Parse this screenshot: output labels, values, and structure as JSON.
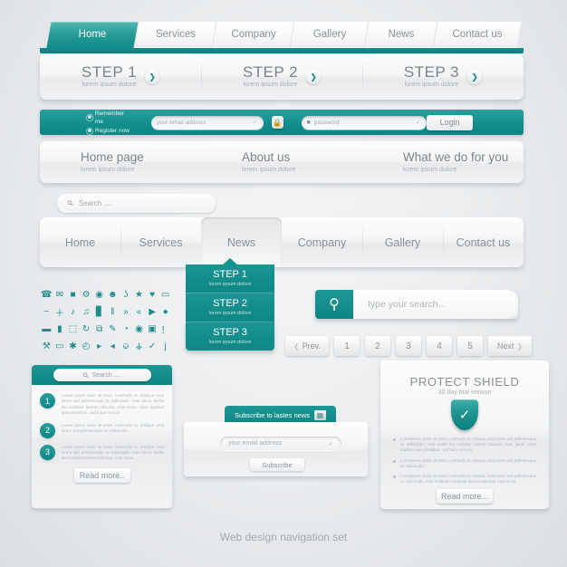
{
  "caption": "Web design navigation set",
  "colors": {
    "teal_light": "#36a5a1",
    "teal_mid": "#1d9492",
    "teal_dark": "#0c8584",
    "panel_light": "#fdfdfd",
    "panel_shadow": "#e9eaec",
    "text_grey": "#8b9094",
    "text_light": "#aeb3b7",
    "page_bg": "#eceef0"
  },
  "top_nav": {
    "active_index": 0,
    "tabs": [
      {
        "label": "Home"
      },
      {
        "label": "Services"
      },
      {
        "label": "Company"
      },
      {
        "label": "Gallery"
      },
      {
        "label": "News"
      },
      {
        "label": "Contact us"
      }
    ]
  },
  "steps_strip": {
    "items": [
      {
        "title": "STEP 1",
        "subtitle": "lorem ipsum dolore",
        "arrow": "chevron-right-icon"
      },
      {
        "title": "STEP 2",
        "subtitle": "lorem ipsum dolore",
        "arrow": "chevron-right-icon"
      },
      {
        "title": "STEP 3",
        "subtitle": "lorem ipsum dolore",
        "arrow": "chevron-right-icon"
      }
    ]
  },
  "login_bar": {
    "remember_me": "Remember me",
    "register_now": "Register now",
    "email_placeholder": "your email address",
    "password_placeholder": "password",
    "login_label": "Login",
    "lock_icon": "lock-icon",
    "check_icon": "check-icon"
  },
  "info_strip": {
    "items": [
      {
        "title": "Home page",
        "subtitle": "lorem ipsum dolore"
      },
      {
        "title": "About us",
        "subtitle": "lorem ipsum dolore"
      },
      {
        "title": "What we do for you",
        "subtitle": "lorem ipsum dolore"
      }
    ]
  },
  "small_search": {
    "placeholder": "Search ....",
    "icon": "search-icon"
  },
  "main_nav": {
    "active_index": 2,
    "items": [
      {
        "label": "Home"
      },
      {
        "label": "Services"
      },
      {
        "label": "News"
      },
      {
        "label": "Company"
      },
      {
        "label": "Gallery"
      },
      {
        "label": "Contact us"
      }
    ]
  },
  "dropdown": {
    "items": [
      {
        "title": "STEP 1",
        "subtitle": "lorem ipsum dolore"
      },
      {
        "title": "STEP 2",
        "subtitle": "lorem ipsum dolore"
      },
      {
        "title": "STEP 3",
        "subtitle": "lorem ipsum dolore"
      }
    ]
  },
  "icon_grid": {
    "rows": [
      [
        {
          "name": "phone-icon",
          "glyph": "✆"
        },
        {
          "name": "envelope-icon",
          "glyph": "✉"
        },
        {
          "name": "briefcase-icon",
          "glyph": "ὋC"
        },
        {
          "name": "gear-icon",
          "glyph": "⚙"
        },
        {
          "name": "globe-icon",
          "glyph": "◉"
        },
        {
          "name": "user-icon",
          "glyph": "☻"
        },
        {
          "name": "rss-icon",
          "glyph": "ʖ"
        },
        {
          "name": "star-icon",
          "glyph": "★"
        },
        {
          "name": "heart-icon",
          "glyph": "♥"
        },
        {
          "name": "comment-icon",
          "glyph": "▭"
        }
      ],
      [
        {
          "name": "minus-icon",
          "glyph": "−"
        },
        {
          "name": "plus-icon",
          "glyph": "＋"
        },
        {
          "name": "volume-mute-icon",
          "glyph": "ὐ7"
        },
        {
          "name": "volume-up-icon",
          "glyph": "ὐ8"
        },
        {
          "name": "equalizer-icon",
          "glyph": "▐"
        },
        {
          "name": "pause-icon",
          "glyph": "‖"
        },
        {
          "name": "forward-icon",
          "glyph": "»"
        },
        {
          "name": "backward-icon",
          "glyph": "«"
        },
        {
          "name": "play-icon",
          "glyph": "▶"
        },
        {
          "name": "map-pin-icon",
          "glyph": "⮟"
        }
      ],
      [
        {
          "name": "briefcase-alt-icon",
          "glyph": "▬"
        },
        {
          "name": "trash-icon",
          "glyph": "▮"
        },
        {
          "name": "fullscreen-icon",
          "glyph": "⬚"
        },
        {
          "name": "refresh-icon",
          "glyph": "↻"
        },
        {
          "name": "tag-icon",
          "glyph": "⧉"
        },
        {
          "name": "pencil-icon",
          "glyph": "✎"
        },
        {
          "name": "pie-chart-icon",
          "glyph": "◔"
        },
        {
          "name": "eye-icon",
          "glyph": "◉"
        },
        {
          "name": "save-icon",
          "glyph": "▣"
        },
        {
          "name": "exclamation-icon",
          "glyph": "！"
        }
      ],
      [
        {
          "name": "wrench-icon",
          "glyph": "⚒"
        },
        {
          "name": "camera-icon",
          "glyph": "▭"
        },
        {
          "name": "asterisk-icon",
          "glyph": "✱"
        },
        {
          "name": "clock-icon",
          "glyph": "◴"
        },
        {
          "name": "next-icon",
          "glyph": "▸"
        },
        {
          "name": "prev-icon",
          "glyph": "◂"
        },
        {
          "name": "printer-icon",
          "glyph": "⎙"
        },
        {
          "name": "lock-icon",
          "glyph": "ὑ2"
        },
        {
          "name": "check-icon",
          "glyph": "✓"
        },
        {
          "name": "info-icon",
          "glyph": "i"
        }
      ]
    ]
  },
  "big_search": {
    "placeholder": "type your search...",
    "icon": "search-icon"
  },
  "pagination": {
    "prev_label": "Prev.",
    "next_label": "Next",
    "pages": [
      "1",
      "2",
      "3",
      "4",
      "5"
    ],
    "prev_icon": "chevron-left-icon",
    "next_icon": "chevron-right-icon"
  },
  "left_widget": {
    "search_placeholder": "Search ....",
    "search_icon": "search-icon",
    "items": [
      {
        "number": "1",
        "text": "Lorem ipsum dolor sit amet, commodo et, tristique urna lorem sed pellentesque ac sollicitudin. Ante lacus. Mollis leo curabitur laoreet ridiculus. Ante lacus. Vitae dapibus quis penatibus, sed fusce urna in"
      },
      {
        "number": "2",
        "text": "Lorem ipsum dolor sit amet, commodo et, tristique urna lorem sed pellentesque ac sollicitudin."
      },
      {
        "number": "3",
        "text": "Lorem ipsum dolor sit amet, commodo et, tristique urna lorem sed pellentesque ac sollicitudin. Ante lacus. Mollis leo curabitur laoreet ridiculus. Ante lacus."
      }
    ],
    "read_more": "Read more.."
  },
  "newsletter": {
    "title": "Subscribe to lastes news",
    "icon": "newspaper-icon",
    "email_placeholder": "your email address",
    "check_icon": "check-icon",
    "subscribe_label": "Subscribe"
  },
  "protect_shield": {
    "title": "PROTECT SHIELD",
    "subtitle": "30 day trial version",
    "icon": "shield-check-icon",
    "bullets": [
      "Loremipsum dolor sit amet, commodo et, tristique urna lorem sed pellentesque ac sollicitudin. Ante mollis leo curabitur laoreet ridiculus. Ante lacus. Vitae dapibus quis penatibus, sed fusce urna in",
      "Loremipsum dolor sit amet, commodo et, tristique urna lorem sed pellentesque ac sollicitudin.",
      "Loremipsum dolor sit amet, commodo et, tristique urna lorem sed pellentesque ac sollicitudin. Ante mollis leo curabitur laoreet ridiculus. Ante lacus."
    ],
    "read_more": "Read more..."
  }
}
